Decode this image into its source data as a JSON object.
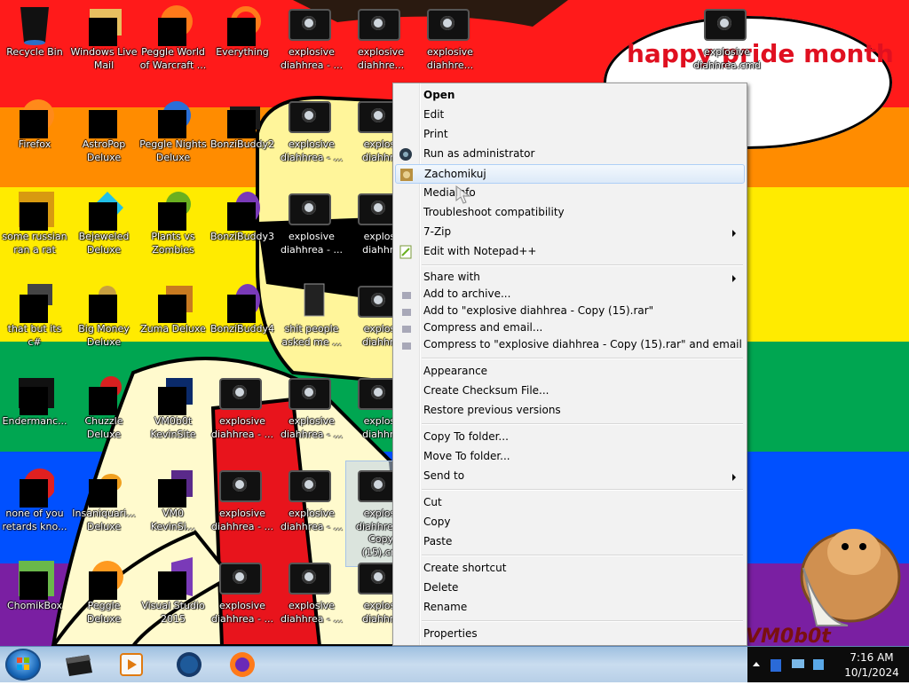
{
  "wallpaper": {
    "stripes": [
      "#ff1a1a",
      "#ff8c00",
      "#ffeb00",
      "#00a651",
      "#0050ff",
      "#7a1fa2"
    ],
    "speech_text": "happy pride month",
    "watermark": "VM0b0t"
  },
  "desktop_icons": [
    {
      "label": "Recycle Bin"
    },
    {
      "label": "Windows Live\nMail"
    },
    {
      "label": "Peggle World\nof Warcraft ..."
    },
    {
      "label": "Everything"
    },
    {
      "label": "explosive\ndiahhrea - ..."
    },
    {
      "label": "explosive\ndiahhre..."
    },
    {
      "label": "explosive\ndiahhre..."
    },
    {
      "label": "explosive\ndiahhrea.cmd"
    },
    {
      "label": "Firefox"
    },
    {
      "label": "AstroPop\nDeluxe"
    },
    {
      "label": "Peggle Nights\nDeluxe"
    },
    {
      "label": "BonziBuddy2"
    },
    {
      "label": "explosive\ndiahhrea - ..."
    },
    {
      "label": "explosi\ndiahhre"
    },
    {
      "label": "some russian\nran a rat"
    },
    {
      "label": "Bejeweled\nDeluxe"
    },
    {
      "label": "Plants vs\nZombies"
    },
    {
      "label": "BonziBuddy3"
    },
    {
      "label": "explosive\ndiahhrea - ..."
    },
    {
      "label": "explosi\ndiahhre"
    },
    {
      "label": "that but its c#"
    },
    {
      "label": "Big Money\nDeluxe"
    },
    {
      "label": "Zuma Deluxe"
    },
    {
      "label": "BonziBuddy4"
    },
    {
      "label": "shit people\nasked me ..."
    },
    {
      "label": "explosi\ndiahhre"
    },
    {
      "label": "Endermanc..."
    },
    {
      "label": "Chuzzle\nDeluxe"
    },
    {
      "label": "VM0b0t\nKevinSite"
    },
    {
      "label": "explosive\ndiahhrea - ..."
    },
    {
      "label": "explosive\ndiahhrea - ..."
    },
    {
      "label": "explosi\ndiahhre"
    },
    {
      "label": "none of you\nretards kno..."
    },
    {
      "label": "Insaniquari...\nDeluxe"
    },
    {
      "label": "VM0\nKevinSi..."
    },
    {
      "label": "explosive\ndiahhrea - ..."
    },
    {
      "label": "explosive\ndiahhrea - ..."
    },
    {
      "label": "explosi\ndiahhrea -\nCopy\n(15).cm"
    },
    {
      "label": "ChomikBox"
    },
    {
      "label": "Peggle Deluxe"
    },
    {
      "label": "Visual Studio\n2015"
    },
    {
      "label": "explosive\ndiahhrea - ..."
    },
    {
      "label": "explosive\ndiahhrea - ..."
    },
    {
      "label": "explosi\ndiahhre"
    }
  ],
  "context_menu": {
    "items": [
      {
        "label": "Open",
        "bold": true
      },
      {
        "label": "Edit"
      },
      {
        "label": "Print"
      },
      {
        "label": "Run as administrator",
        "icon": "shield-icon"
      },
      {
        "label": "Zachomikuj",
        "icon": "chomikbox-icon",
        "highlighted": true
      },
      {
        "label": "MediaInfo"
      },
      {
        "label": "Troubleshoot compatibility"
      },
      {
        "label": "7-Zip",
        "submenu": true
      },
      {
        "label": "Edit with Notepad++",
        "icon": "notepadpp-icon"
      },
      {
        "label": "Share with",
        "submenu": true
      },
      {
        "label": "Add to archive...",
        "icon": "winrar-icon"
      },
      {
        "label": "Add to \"explosive diahhrea - Copy (15).rar\"",
        "icon": "winrar-icon"
      },
      {
        "label": "Compress and email...",
        "icon": "winrar-icon"
      },
      {
        "label": "Compress to \"explosive diahhrea - Copy (15).rar\" and email",
        "icon": "winrar-icon"
      },
      {
        "label": "Appearance"
      },
      {
        "label": "Create Checksum File..."
      },
      {
        "label": "Restore previous versions"
      },
      {
        "label": "Copy To folder..."
      },
      {
        "label": "Move To folder..."
      },
      {
        "label": "Send to",
        "submenu": true
      },
      {
        "label": "Cut"
      },
      {
        "label": "Copy"
      },
      {
        "label": "Paste"
      },
      {
        "label": "Create shortcut"
      },
      {
        "label": "Delete"
      },
      {
        "label": "Rename"
      },
      {
        "label": "Properties"
      }
    ]
  },
  "taskbar": {
    "pinned": [
      "explorer-icon",
      "media-player-icon",
      "vm-globe-icon",
      "firefox-icon"
    ],
    "clock_time": "7:16 AM",
    "clock_date": "10/1/2024"
  }
}
